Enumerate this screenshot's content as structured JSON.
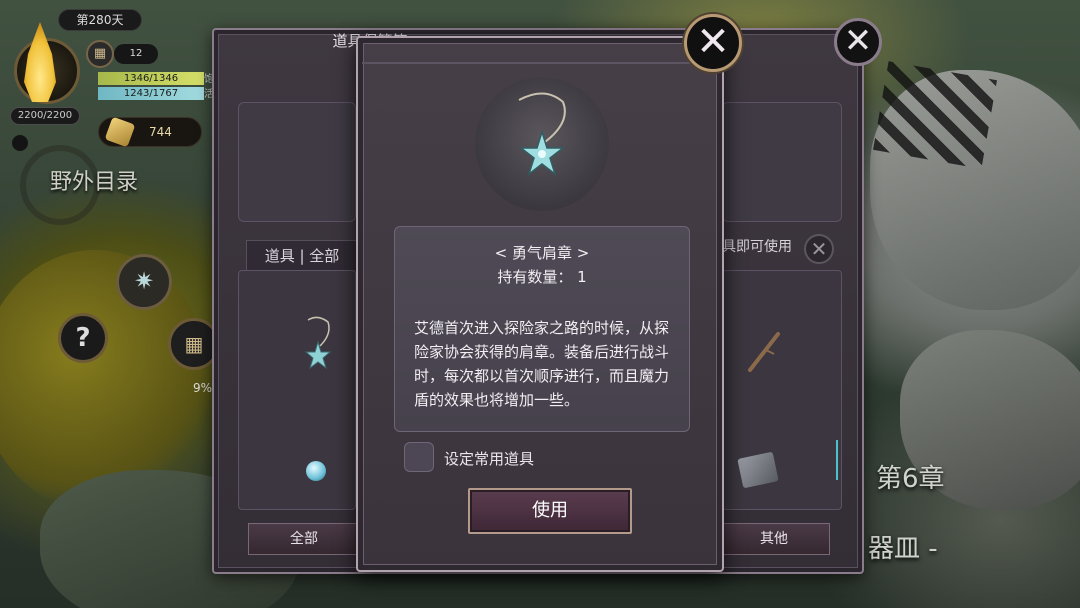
{
  "hud": {
    "day": "第280天",
    "calendar_count": "12",
    "hp": "1346/1346",
    "hp_tail": "饱",
    "mp": "1243/1767",
    "mp_tail": "活",
    "stamina": "2200/2200",
    "gold": "744",
    "field_directory": "野外目录",
    "progress_percent": "9%",
    "help": "?"
  },
  "map": {
    "chapter": "第6章",
    "chapter_sub": "器皿 -"
  },
  "item_box": {
    "title": "道具保管箱",
    "tab": "道具 | 全部",
    "use_hint": "具即可使用",
    "bottom_tabs": [
      "全部",
      "其他"
    ]
  },
  "dialog": {
    "item_name": "< 勇气肩章 >",
    "quantity_label": "持有数量：",
    "quantity": "1",
    "description": "艾德首次进入探险家之路的时候，从探险家协会获得的肩章。装备后进行战斗时，每次都以首次顺序进行，而且魔力盾的效果也将增加一些。",
    "favorite_label": "设定常用道具",
    "use_button": "使用",
    "close_glyph": "✕"
  },
  "icons": {
    "close": "close-icon",
    "calendar": "calendar-icon",
    "gear": "gear-icon",
    "gold": "gold-icon",
    "pendant": "pendant-icon"
  },
  "colors": {
    "panel": "#3f3841",
    "dialog": "#473f47",
    "accent_border": "#b79a74",
    "hp_bar": "#c7d45c",
    "mp_bar": "#8fd0d8"
  }
}
